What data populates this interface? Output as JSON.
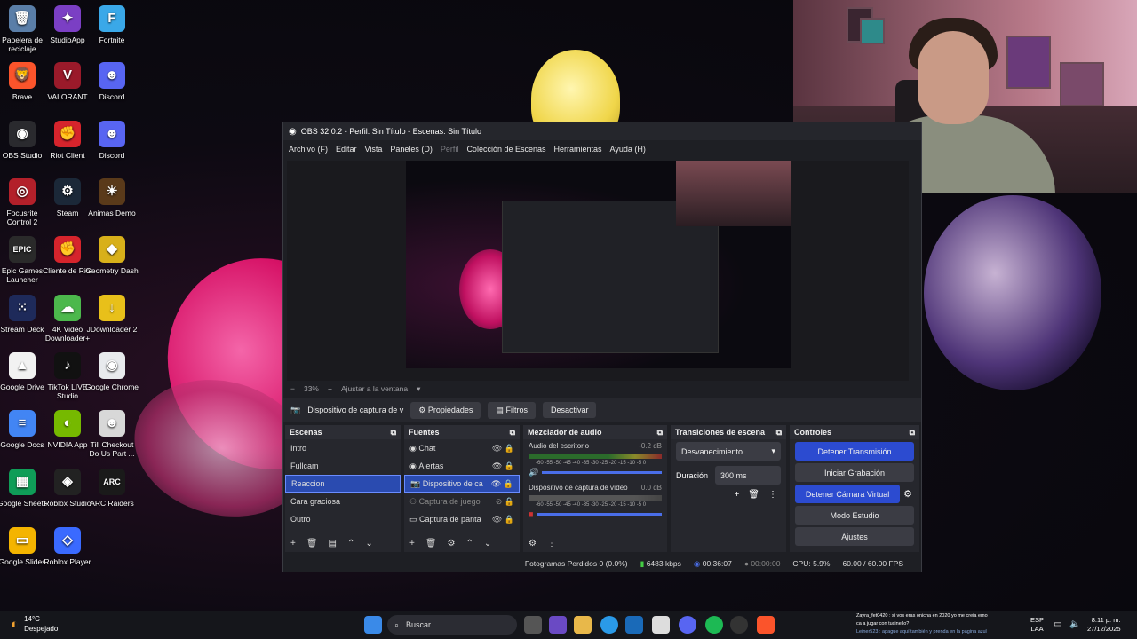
{
  "desktop": {
    "icons": [
      {
        "label": "Papelera de reciclaje",
        "icon": "recycle-bin-icon",
        "color": "#5a7ea8",
        "glyph": "🗑"
      },
      {
        "label": "StudioApp",
        "icon": "studioapp-icon",
        "color": "#7b3fc4",
        "glyph": "✦"
      },
      {
        "label": "Fortnite",
        "icon": "fortnite-icon",
        "color": "#3aa8e8",
        "glyph": "F"
      },
      {
        "label": "Brave",
        "icon": "brave-icon",
        "color": "#fb542b",
        "glyph": "🦁"
      },
      {
        "label": "VALORANT",
        "icon": "valorant-icon",
        "color": "#9a1a2a",
        "glyph": "V"
      },
      {
        "label": "Discord",
        "icon": "discord-icon",
        "color": "#5865f2",
        "glyph": "☻"
      },
      {
        "label": "OBS Studio",
        "icon": "obs-icon",
        "color": "#2a2a2e",
        "glyph": "◉"
      },
      {
        "label": "Riot Client",
        "icon": "riot-client-icon",
        "color": "#d6242c",
        "glyph": "✊"
      },
      {
        "label": "Discord",
        "icon": "discord-icon",
        "color": "#5865f2",
        "glyph": "☻"
      },
      {
        "label": "Focusrite Control 2",
        "icon": "focusrite-icon",
        "color": "#b3202a",
        "glyph": "◎"
      },
      {
        "label": "Steam",
        "icon": "steam-icon",
        "color": "#1b2838",
        "glyph": "⚙"
      },
      {
        "label": "Animas Demo",
        "icon": "animas-icon",
        "color": "#5a3a1a",
        "glyph": "☀"
      },
      {
        "label": "Epic Games Launcher",
        "icon": "epic-games-icon",
        "color": "#2a2a2a",
        "glyph": "EPIC"
      },
      {
        "label": "Cliente de Riot",
        "icon": "riot-client-icon",
        "color": "#d6242c",
        "glyph": "✊"
      },
      {
        "label": "Geometry Dash",
        "icon": "geometry-dash-icon",
        "color": "#d8b01a",
        "glyph": "◆"
      },
      {
        "label": "Stream Deck",
        "icon": "stream-deck-icon",
        "color": "#1e2a5a",
        "glyph": "⁙"
      },
      {
        "label": "4K Video Downloader+",
        "icon": "downloader-icon",
        "color": "#4cb84c",
        "glyph": "☁"
      },
      {
        "label": "JDownloader 2",
        "icon": "jdownloader-icon",
        "color": "#e8c01a",
        "glyph": "↓"
      },
      {
        "label": "Google Drive",
        "icon": "google-drive-icon",
        "color": "#f2f2f2",
        "glyph": "▲"
      },
      {
        "label": "TikTok LIVE Studio",
        "icon": "tiktok-icon",
        "color": "#111111",
        "glyph": "♪"
      },
      {
        "label": "Google Chrome",
        "icon": "chrome-icon",
        "color": "#e8eaed",
        "glyph": "◉"
      },
      {
        "label": "Google Docs",
        "icon": "google-docs-icon",
        "color": "#4285f4",
        "glyph": "≡"
      },
      {
        "label": "NVIDIA App",
        "icon": "nvidia-icon",
        "color": "#76b900",
        "glyph": "◐"
      },
      {
        "label": "Till Checkout Do Us Part ...",
        "icon": "game-icon",
        "color": "#d8d8d8",
        "glyph": "☻"
      },
      {
        "label": "Google Sheets",
        "icon": "google-sheets-icon",
        "color": "#0f9d58",
        "glyph": "▦"
      },
      {
        "label": "Roblox Studio",
        "icon": "roblox-studio-icon",
        "color": "#222222",
        "glyph": "◈"
      },
      {
        "label": "ARC Raiders",
        "icon": "arc-raiders-icon",
        "color": "#1a1a1a",
        "glyph": "ARC"
      },
      {
        "label": "Google Slides",
        "icon": "google-slides-icon",
        "color": "#f4b400",
        "glyph": "▭"
      },
      {
        "label": "Roblox Player",
        "icon": "roblox-player-icon",
        "color": "#3a6aff",
        "glyph": "◇"
      }
    ]
  },
  "obs": {
    "title": "OBS 32.0.2 - Perfil: Sin Título - Escenas: Sin Título",
    "menu": [
      "Archivo (F)",
      "Editar",
      "Vista",
      "Paneles (D)",
      "Perfil",
      "Colección de Escenas",
      "Herramientas",
      "Ayuda (H)"
    ],
    "zoom": "33%",
    "fit_label": "Ajustar a la ventana",
    "source_bar": {
      "name": "Dispositivo de captura de v",
      "properties": "Propiedades",
      "filters": "Filtros",
      "deactivate": "Desactivar"
    },
    "scenes": {
      "title": "Escenas",
      "items": [
        "Intro",
        "Fullcam",
        "Reaccion",
        "Cara graciosa",
        "Outro"
      ],
      "selected": "Reaccion"
    },
    "sources": {
      "title": "Fuentes",
      "items": [
        "Chat",
        "Alertas",
        "Dispositivo de ca",
        "Captura de juego",
        "Captura de panta"
      ]
    },
    "mixer": {
      "title": "Mezclador de audio",
      "channels": [
        {
          "name": "Audio del escritorio",
          "db": "-0.2 dB"
        },
        {
          "name": "Dispositivo de captura de vídeo",
          "db": "0.0 dB"
        }
      ],
      "scale": "-60 -55 -50 -45 -40 -35 -30 -25 -20 -15 -10 -5 0"
    },
    "transitions": {
      "title": "Transiciones de escena",
      "selected": "Desvanecimiento",
      "duration_label": "Duración",
      "duration": "300 ms"
    },
    "controls": {
      "title": "Controles",
      "buttons": [
        "Detener Transmisión",
        "Iniciar Grabación",
        "Detener Cámara Virtual",
        "Modo Estudio",
        "Ajustes"
      ]
    },
    "status": {
      "dropped": "Fotogramas Perdidos 0 (0.0%)",
      "bitrate": "6483 kbps",
      "stream_time": "00:36:07",
      "rec_time": "00:00:00",
      "cpu": "CPU: 5.9%",
      "fps": "60.00 / 60.00 FPS"
    }
  },
  "taskbar": {
    "weather_temp": "14°C",
    "weather_desc": "Despejado",
    "search_placeholder": "Buscar",
    "chat_lines": [
      "Zayra_fet0420 : si vos eras onicha en 2020 yo me creia emo",
      "ca a jugar con tucinello?",
      "Leiner523 : apague aquí también y prenda en la página azul"
    ],
    "lang": "ESP",
    "lang2": "LAA",
    "time": "8:11 p. m.",
    "date": "27/12/2025"
  }
}
